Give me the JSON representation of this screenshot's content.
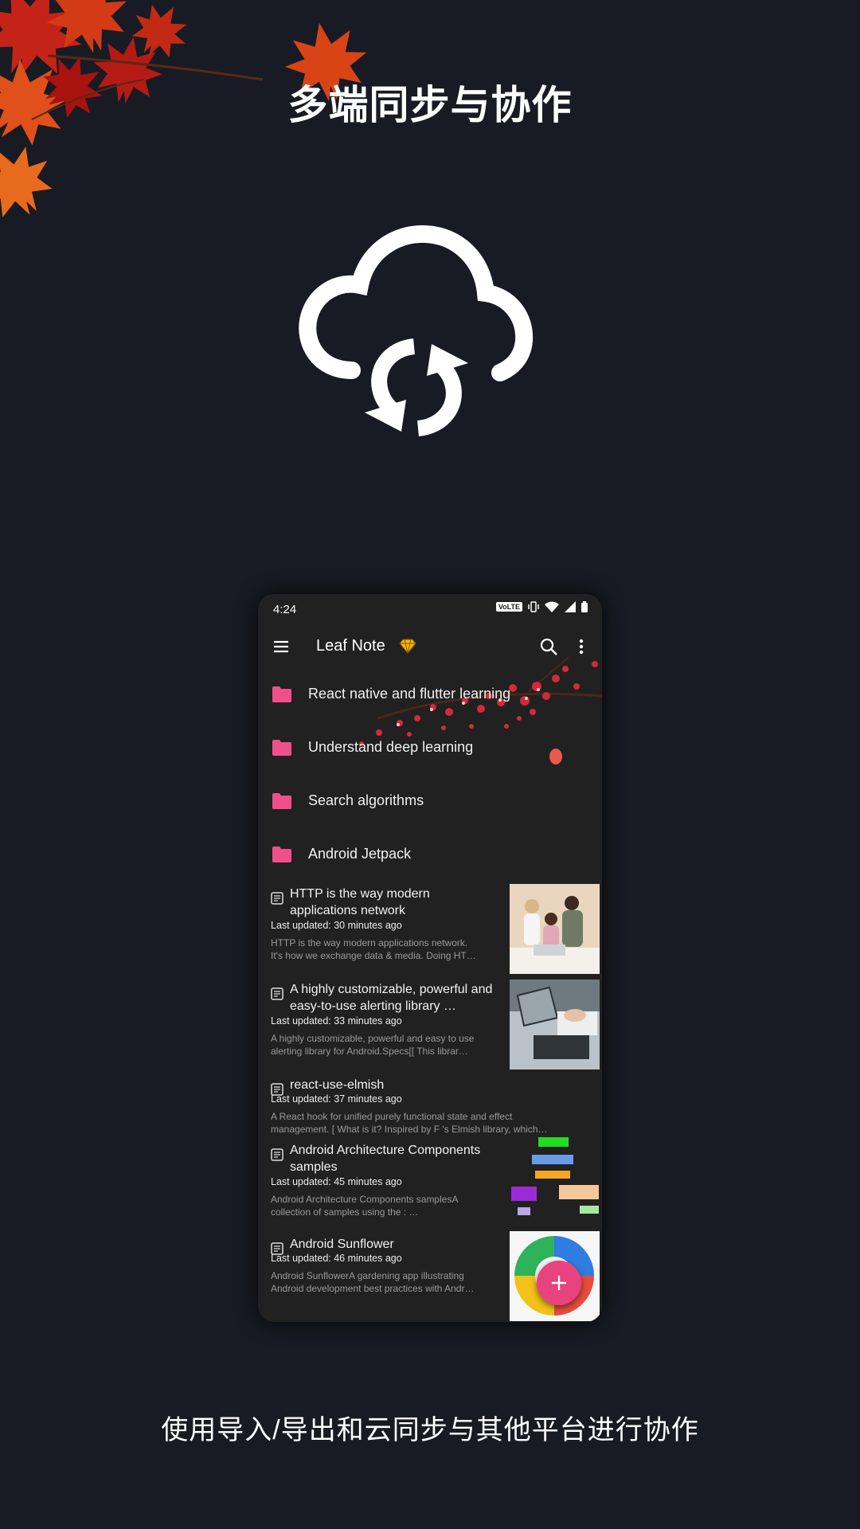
{
  "headline": "多端同步与协作",
  "caption": "使用导入/导出和云同步与其他平台进行协作",
  "status_bar": {
    "time": "4:24",
    "volte": "VoLTE"
  },
  "app_bar": {
    "title": "Leaf Note",
    "menu_icon": "hamburger-menu-icon",
    "premium_icon": "diamond-icon",
    "search_icon": "search-icon",
    "more_icon": "more-vert-icon"
  },
  "folders": [
    {
      "label": "React native and flutter learning"
    },
    {
      "label": "Understand deep learning"
    },
    {
      "label": "Search algorithms"
    },
    {
      "label": "Android Jetpack"
    }
  ],
  "notes": [
    {
      "title": "HTTP is the way modern applications network",
      "updated": "Last updated: 30 minutes ago",
      "body_line1": "HTTP is the way modern applications network.",
      "body_line2": "It's how we exchange data & media. Doing HT…"
    },
    {
      "title": "A highly customizable, powerful and easy-to-use alerting library …",
      "updated": "Last updated: 33 minutes ago",
      "body_line1": "A highly customizable, powerful and easy to use",
      "body_line2": "alerting library for Android.Specs[[   This librar…"
    },
    {
      "title": "react-use-elmish",
      "updated": "Last updated: 37 minutes ago",
      "body_line1": "A React hook for unified purely functional state and effect",
      "body_line2": "management.  [     What is it?  Inspired by F 's Elmish library, which…"
    },
    {
      "title": "Android Architecture Components samples",
      "updated": "Last updated: 45 minutes ago",
      "body_line1": "Android Architecture Components samplesA",
      "body_line2": "collection of samples using the :                    …"
    },
    {
      "title": "Android Sunflower",
      "updated": "Last updated: 46 minutes ago",
      "body_line1": "Android SunflowerA gardening app illustrating",
      "body_line2": "Android development best practices with Andr…"
    }
  ],
  "colors": {
    "background": "#191b24",
    "phone_bg": "#212121",
    "accent_pink": "#e8437f",
    "folder_pink": "#f0508a"
  }
}
